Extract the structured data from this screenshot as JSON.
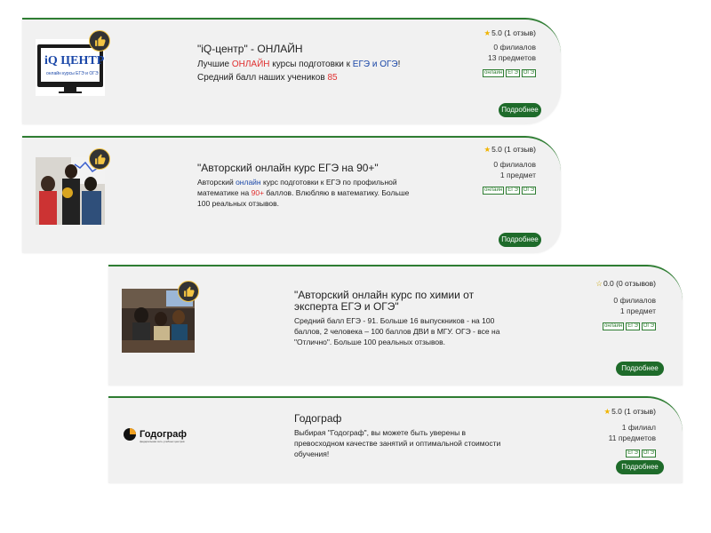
{
  "listings": [
    {
      "title": "\"iQ-центр\" - ОНЛАЙН",
      "desc_1": "Лучшие ",
      "desc_online": "ОНЛАЙН",
      "desc_2": " курсы подготовки к ",
      "desc_ege": "ЕГЭ",
      "desc_and": " и ",
      "desc_oge": "ОГЭ",
      "desc_3": "!",
      "desc_line2": "Средний балл наших учеников ",
      "desc_score": "85",
      "rating_value": "5.0",
      "rating_count": "(1 отзыв)",
      "branches": "0 филиалов",
      "subjects": "13 предметов",
      "tags": [
        "онлайн",
        "ЕГЭ",
        "ОГЭ"
      ],
      "button": "Подробнее",
      "logo_text": "iQ ЦЕНТР",
      "logo_sub": "онлайн курсы ЕГЭ и ОГЭ"
    },
    {
      "title": "\"Авторский онлайн курс ЕГЭ на 90+\"",
      "desc_1": "Авторский ",
      "desc_online": "онлайн",
      "desc_2": " курс подготовки к ЕГЭ по профильной",
      "desc_line2a": "математике на ",
      "desc_score": "90+",
      "desc_line2b": " баллов. Влюбляю в математику. Больше",
      "desc_line3": "100 реальных отзывов.",
      "rating_value": "5.0",
      "rating_count": "(1 отзыв)",
      "branches": "0 филиалов",
      "subjects": "1 предмет",
      "tags": [
        "онлайн",
        "ЕГЭ",
        "ОГЭ"
      ],
      "button": "Подробнее"
    },
    {
      "title": "\"Авторский онлайн курс по химии от эксперта ЕГЭ и ОГЭ\"",
      "desc": "Средний балл ЕГЭ - 91. Больше 16 выпускников - на 100 баллов, 2 человека – 100 баллов ДВИ в МГУ. ОГЭ - все на \"Отлично\". Больше 100 реальных отзывов.",
      "rating_value": "0.0",
      "rating_count": "(0 отзывов)",
      "branches": "0 филиалов",
      "subjects": "1 предмет",
      "tags": [
        "онлайн",
        "ЕГЭ",
        "ОГЭ"
      ],
      "button": "Подробнее"
    },
    {
      "title": "Годограф",
      "desc": "Выбирая \"Годограф\", вы можете быть уверены в превосходном качестве занятий и оптимальной стоимости обучения!",
      "rating_value": "5.0",
      "rating_count": "(1 отзыв)",
      "branches": "1 филиал",
      "subjects": "11 предметов",
      "tags": [
        "ЕГЭ",
        "ОГЭ"
      ],
      "button": "Подробнее",
      "logo_text": "Годограф",
      "logo_sub": "федеральная сеть учебных центров"
    }
  ],
  "colors": {
    "accent_green": "#1e6b2a",
    "highlight_red": "#e03030",
    "highlight_blue": "#1a47a8",
    "star": "#f0b400"
  },
  "icons": [
    "thumbs-up-icon",
    "star-icon",
    "star-empty-icon"
  ]
}
